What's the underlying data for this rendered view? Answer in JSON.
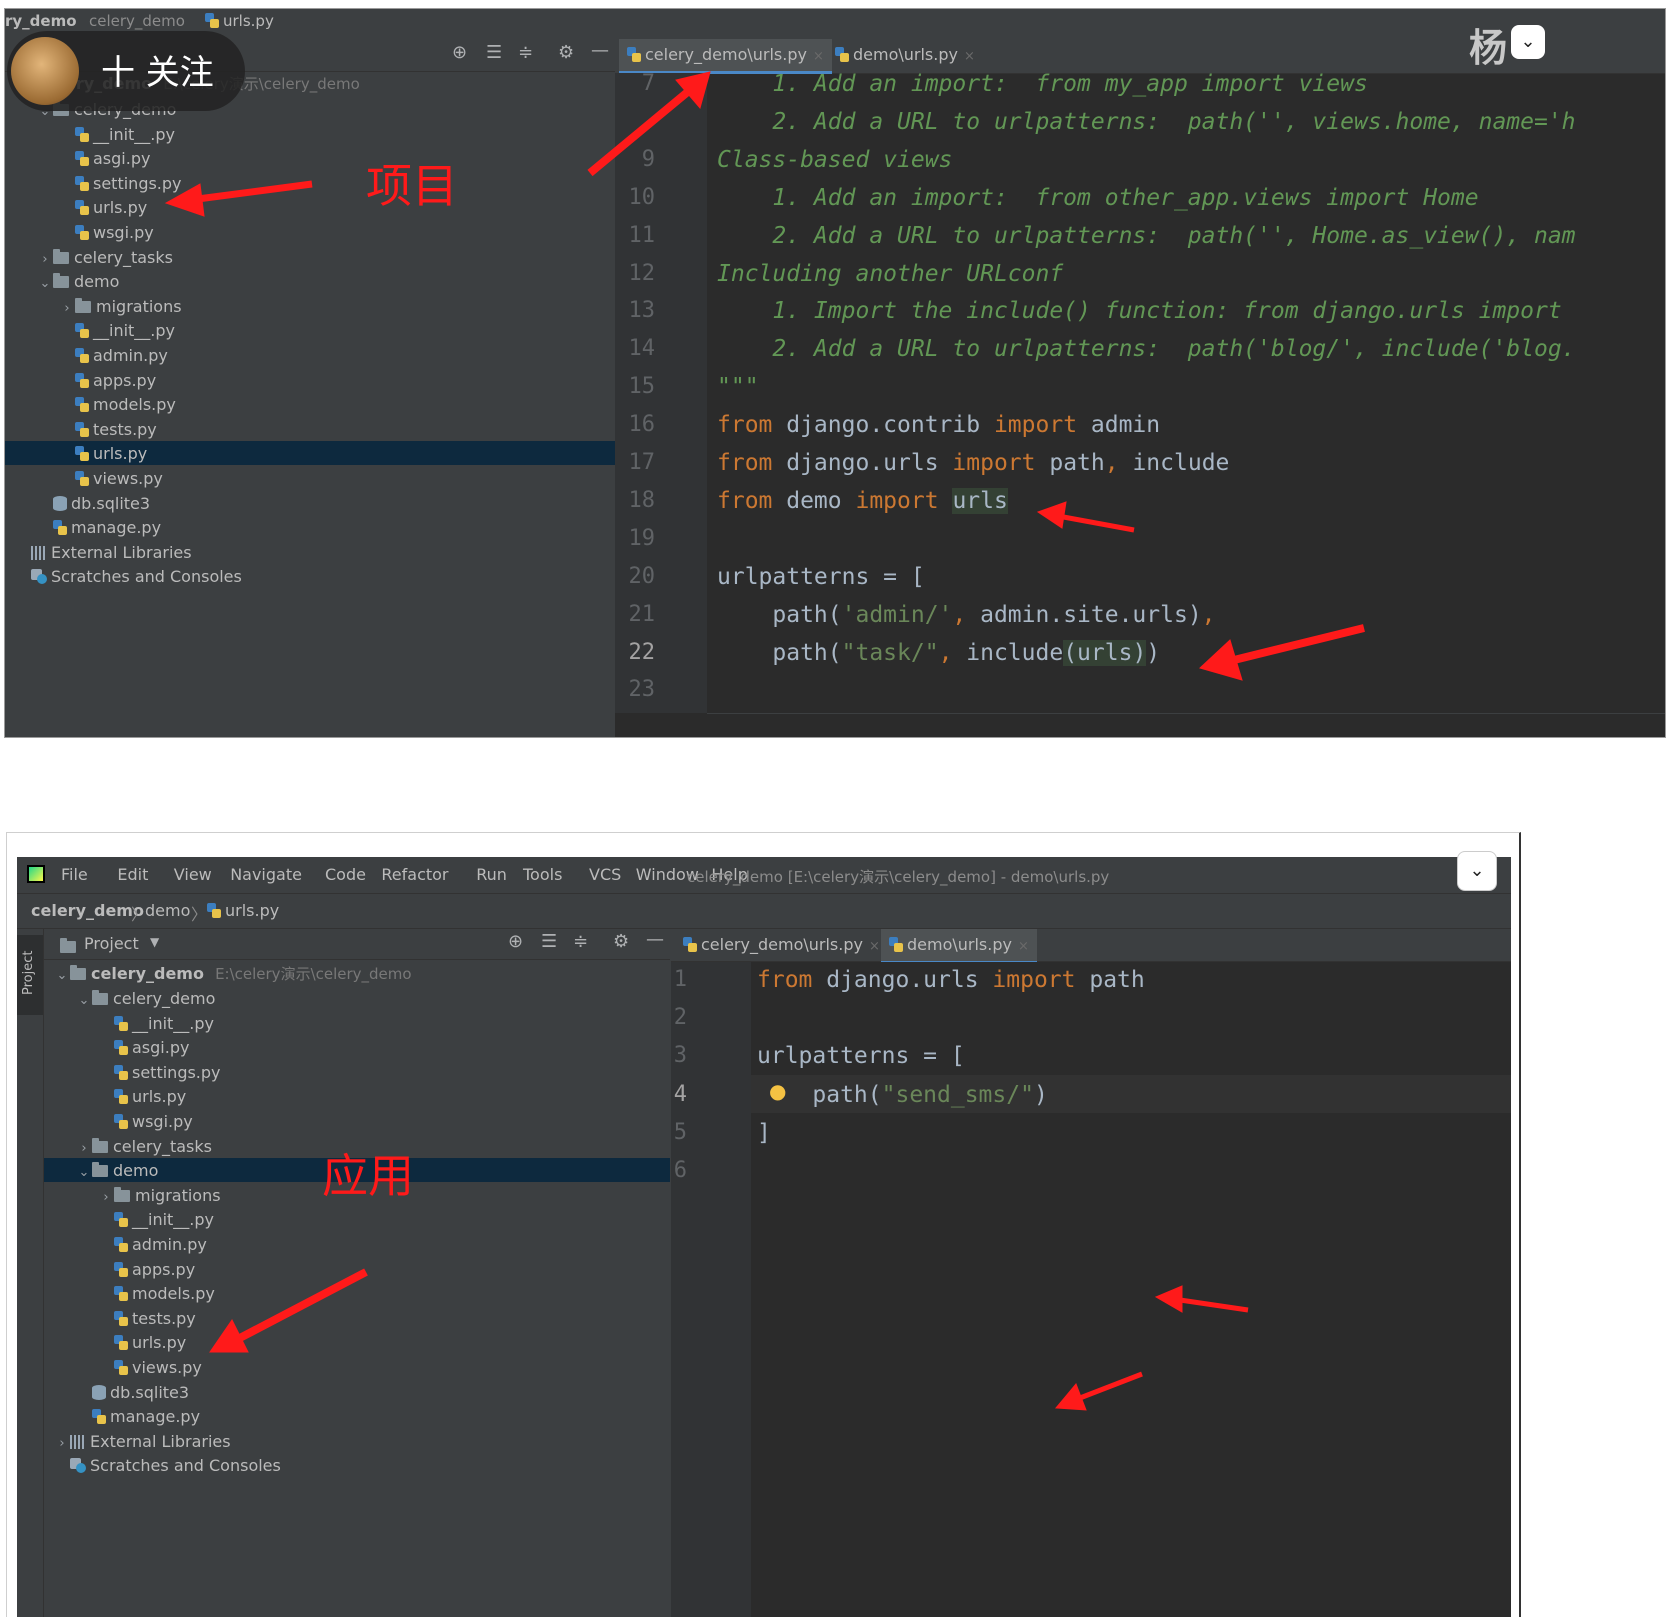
{
  "top": {
    "breadcrumb": [
      "ry_demo",
      "celery_demo",
      "urls.py"
    ],
    "follow_overlay": "十 关注",
    "watermark": "杨",
    "root_label": "ery_demo",
    "root_path": "E:\\celery演示\\celery_demo",
    "tabs": [
      "celery_demo\\urls.py",
      "demo\\urls.py"
    ],
    "annotation": "项目",
    "tree": [
      {
        "label": "celery_demo",
        "type": "folder",
        "expanded": true,
        "indent": 1
      },
      {
        "label": "__init__.py",
        "type": "py",
        "indent": 2
      },
      {
        "label": "asgi.py",
        "type": "py",
        "indent": 2
      },
      {
        "label": "settings.py",
        "type": "py",
        "indent": 2
      },
      {
        "label": "urls.py",
        "type": "py",
        "indent": 2
      },
      {
        "label": "wsgi.py",
        "type": "py",
        "indent": 2
      },
      {
        "label": "celery_tasks",
        "type": "folder",
        "expanded": false,
        "indent": 1
      },
      {
        "label": "demo",
        "type": "folder",
        "expanded": true,
        "indent": 1
      },
      {
        "label": "migrations",
        "type": "folder",
        "expanded": false,
        "indent": 2
      },
      {
        "label": "__init__.py",
        "type": "py",
        "indent": 2
      },
      {
        "label": "admin.py",
        "type": "py",
        "indent": 2
      },
      {
        "label": "apps.py",
        "type": "py",
        "indent": 2
      },
      {
        "label": "models.py",
        "type": "py",
        "indent": 2
      },
      {
        "label": "tests.py",
        "type": "py",
        "indent": 2
      },
      {
        "label": "urls.py",
        "type": "py",
        "indent": 2,
        "selected": true
      },
      {
        "label": "views.py",
        "type": "py",
        "indent": 2
      },
      {
        "label": "db.sqlite3",
        "type": "db",
        "indent": 1
      },
      {
        "label": "manage.py",
        "type": "py",
        "indent": 1
      },
      {
        "label": "External Libraries",
        "type": "lib",
        "indent": 0
      },
      {
        "label": "Scratches and Consoles",
        "type": "scr",
        "indent": 0
      }
    ],
    "line_numbers": [
      "7",
      "",
      "9",
      "10",
      "11",
      "12",
      "13",
      "14",
      "15",
      "16",
      "17",
      "18",
      "19",
      "20",
      "21",
      "22",
      "23"
    ],
    "code": [
      [
        {
          "t": "    1. Add an import:  from my_app import views",
          "c": "cm"
        }
      ],
      [
        {
          "t": "    2. Add a URL to urlpatterns:  path('', views.home, name='h",
          "c": "cm"
        }
      ],
      [
        {
          "t": "Class-based views",
          "c": "cm"
        }
      ],
      [
        {
          "t": "    1. Add an import:  from other_app.views import Home",
          "c": "cm"
        }
      ],
      [
        {
          "t": "    2. Add a URL to urlpatterns:  path('', Home.as_view(), nam",
          "c": "cm"
        }
      ],
      [
        {
          "t": "Including another URLconf",
          "c": "cm"
        }
      ],
      [
        {
          "t": "    1. Import the include() function: from django.urls import",
          "c": "cm"
        }
      ],
      [
        {
          "t": "    2. Add a URL to urlpatterns:  path('blog/', include('blog.",
          "c": "cm"
        }
      ],
      [
        {
          "t": "\"\"\"",
          "c": "cm"
        }
      ],
      [
        {
          "t": "from",
          "c": "kw"
        },
        {
          "t": " django.contrib ",
          "c": ""
        },
        {
          "t": "import",
          "c": "kw"
        },
        {
          "t": " admin",
          "c": ""
        }
      ],
      [
        {
          "t": "from",
          "c": "kw"
        },
        {
          "t": " django.urls ",
          "c": ""
        },
        {
          "t": "import",
          "c": "kw"
        },
        {
          "t": " path",
          "c": ""
        },
        {
          "t": ",",
          "c": "kw"
        },
        {
          "t": " include",
          "c": ""
        }
      ],
      [
        {
          "t": "from",
          "c": "kw"
        },
        {
          "t": " demo ",
          "c": ""
        },
        {
          "t": "import",
          "c": "kw"
        },
        {
          "t": " ",
          "c": ""
        },
        {
          "t": "urls",
          "c": "hl"
        }
      ],
      [
        {
          "t": "",
          "c": ""
        }
      ],
      [
        {
          "t": "urlpatterns = [",
          "c": ""
        }
      ],
      [
        {
          "t": "    path(",
          "c": ""
        },
        {
          "t": "'admin/'",
          "c": "str"
        },
        {
          "t": ",",
          "c": "kw"
        },
        {
          "t": " admin.site.urls)",
          "c": ""
        },
        {
          "t": ",",
          "c": "kw"
        }
      ],
      [
        {
          "t": "    path(",
          "c": ""
        },
        {
          "t": "\"task/\"",
          "c": "str"
        },
        {
          "t": ",",
          "c": "kw"
        },
        {
          "t": " include",
          "c": ""
        },
        {
          "t": "(urls)",
          "c": "hl"
        },
        {
          "t": ")",
          "c": ""
        }
      ],
      [
        {
          "t": "",
          "c": ""
        }
      ]
    ]
  },
  "bottom": {
    "menu": [
      "File",
      "Edit",
      "View",
      "Navigate",
      "Code",
      "Refactor",
      "Run",
      "Tools",
      "VCS",
      "Window",
      "Help"
    ],
    "window_title": "celery_demo [E:\\celery演示\\celery_demo] - demo\\urls.py",
    "breadcrumb": [
      "celery_demo",
      "demo",
      "urls.py"
    ],
    "project_label": "Project",
    "side_tab": "Project",
    "root_label": "celery_demo",
    "root_path": "E:\\celery演示\\celery_demo",
    "tabs": [
      "celery_demo\\urls.py",
      "demo\\urls.py"
    ],
    "annotation": "应用",
    "tree": [
      {
        "label": "celery_demo",
        "type": "folder",
        "expanded": true,
        "indent": 1
      },
      {
        "label": "__init__.py",
        "type": "py",
        "indent": 2
      },
      {
        "label": "asgi.py",
        "type": "py",
        "indent": 2
      },
      {
        "label": "settings.py",
        "type": "py",
        "indent": 2
      },
      {
        "label": "urls.py",
        "type": "py",
        "indent": 2
      },
      {
        "label": "wsgi.py",
        "type": "py",
        "indent": 2
      },
      {
        "label": "celery_tasks",
        "type": "folder",
        "expanded": false,
        "indent": 1
      },
      {
        "label": "demo",
        "type": "folder",
        "expanded": true,
        "indent": 1,
        "selected": true
      },
      {
        "label": "migrations",
        "type": "folder",
        "expanded": false,
        "indent": 2
      },
      {
        "label": "__init__.py",
        "type": "py",
        "indent": 2
      },
      {
        "label": "admin.py",
        "type": "py",
        "indent": 2
      },
      {
        "label": "apps.py",
        "type": "py",
        "indent": 2
      },
      {
        "label": "models.py",
        "type": "py",
        "indent": 2
      },
      {
        "label": "tests.py",
        "type": "py",
        "indent": 2
      },
      {
        "label": "urls.py",
        "type": "py",
        "indent": 2
      },
      {
        "label": "views.py",
        "type": "py",
        "indent": 2
      },
      {
        "label": "db.sqlite3",
        "type": "db",
        "indent": 1
      },
      {
        "label": "manage.py",
        "type": "py",
        "indent": 1
      },
      {
        "label": "External Libraries",
        "type": "lib",
        "indent": 0,
        "expandable": true
      },
      {
        "label": "Scratches and Consoles",
        "type": "scr",
        "indent": 0
      }
    ],
    "line_numbers": [
      "1",
      "2",
      "3",
      "4",
      "5",
      "6"
    ],
    "code": [
      [
        {
          "t": "from",
          "c": "kw"
        },
        {
          "t": " django.urls ",
          "c": ""
        },
        {
          "t": "import",
          "c": "kw"
        },
        {
          "t": " path",
          "c": ""
        }
      ],
      [
        {
          "t": "",
          "c": ""
        }
      ],
      [
        {
          "t": "urlpatterns = [",
          "c": ""
        }
      ],
      [
        {
          "t": "    path(",
          "c": ""
        },
        {
          "t": "\"send_sms/\"",
          "c": "str"
        },
        {
          "t": ")",
          "c": ""
        }
      ],
      [
        {
          "t": "]",
          "c": ""
        }
      ],
      [
        {
          "t": "",
          "c": ""
        }
      ]
    ]
  },
  "colors": {
    "annotation_red": "#ff1a1a",
    "keyword": "#cc7832",
    "string": "#6a8759",
    "comment": "#629755"
  }
}
